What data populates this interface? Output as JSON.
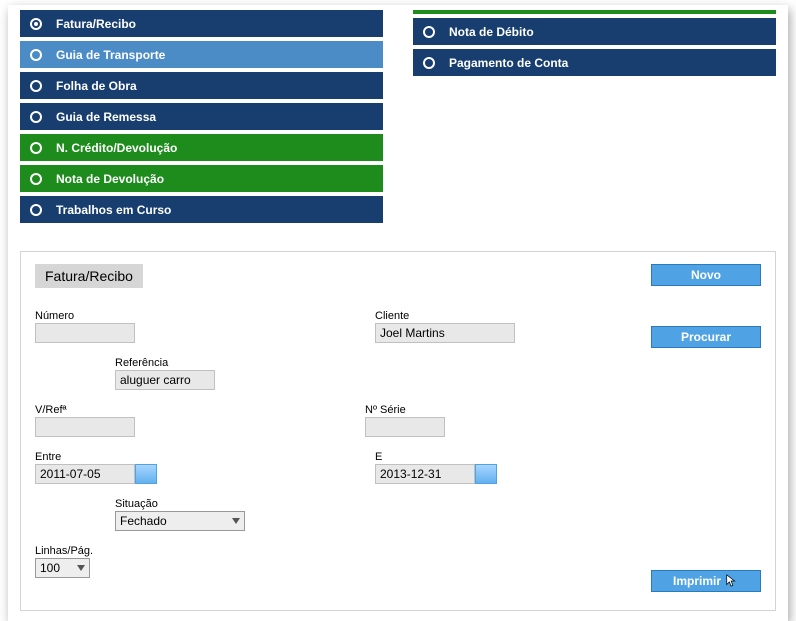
{
  "leftMenu": [
    {
      "label": "Fatura/Recibo",
      "color": "c-navy",
      "selected": true
    },
    {
      "label": "Guia de Transporte",
      "color": "c-blue",
      "selected": false
    },
    {
      "label": "Folha de Obra",
      "color": "c-navy",
      "selected": false
    },
    {
      "label": "Guia de Remessa",
      "color": "c-navy",
      "selected": false
    },
    {
      "label": "N. Crédito/Devolução",
      "color": "c-green",
      "selected": false
    },
    {
      "label": "Nota de Devolução",
      "color": "c-green",
      "selected": false
    },
    {
      "label": "Trabalhos em Curso",
      "color": "c-navy",
      "selected": false
    }
  ],
  "rightMenu": [
    {
      "label": "Nota de Débito",
      "color": "c-navy",
      "selected": false
    },
    {
      "label": "Pagamento de Conta",
      "color": "c-navy",
      "selected": false
    }
  ],
  "panel": {
    "title": "Fatura/Recibo",
    "buttons": {
      "novo": "Novo",
      "procurar": "Procurar",
      "imprimir": "Imprimir"
    },
    "fields": {
      "numero": {
        "label": "Número",
        "value": ""
      },
      "cliente": {
        "label": "Cliente",
        "value": "Joel Martins"
      },
      "referencia": {
        "label": "Referência",
        "value": "aluguer carro"
      },
      "vref": {
        "label": "V/Refª",
        "value": ""
      },
      "nserie": {
        "label": "Nº Série",
        "value": ""
      },
      "entre": {
        "label": "Entre",
        "value": "2011-07-05"
      },
      "e": {
        "label": "E",
        "value": "2013-12-31"
      },
      "situacao": {
        "label": "Situação",
        "value": "Fechado"
      },
      "linhaspag": {
        "label": "Linhas/Pág.",
        "value": "100"
      }
    }
  }
}
